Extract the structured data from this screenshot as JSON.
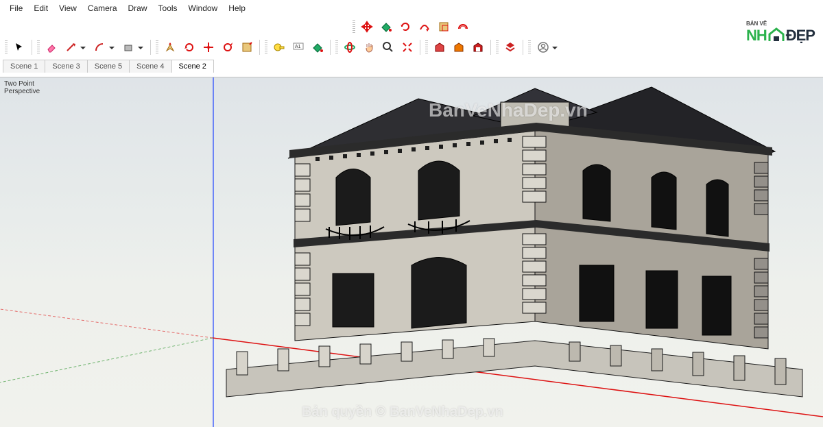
{
  "menu": [
    "File",
    "Edit",
    "View",
    "Camera",
    "Draw",
    "Tools",
    "Window",
    "Help"
  ],
  "top_toolbar": [
    {
      "name": "move-tool",
      "icon": "move-red"
    },
    {
      "name": "paint-bucket",
      "icon": "bucket"
    },
    {
      "name": "rotate-tool",
      "icon": "rotate-red"
    },
    {
      "name": "follow-me",
      "icon": "follow"
    },
    {
      "name": "scale-tool",
      "icon": "scale"
    },
    {
      "name": "offset-tool",
      "icon": "offset-red"
    }
  ],
  "main_toolbar_groups": [
    [
      {
        "name": "select-tool",
        "icon": "cursor",
        "dd": false
      }
    ],
    [
      {
        "name": "eraser-tool",
        "icon": "eraser",
        "dd": false
      },
      {
        "name": "line-tool",
        "icon": "pencil",
        "dd": true
      },
      {
        "name": "arc-tool",
        "icon": "arc",
        "dd": true
      },
      {
        "name": "rectangle-tool",
        "icon": "rect",
        "dd": true
      }
    ],
    [
      {
        "name": "push-pull",
        "icon": "pushpull"
      },
      {
        "name": "move-tool-2",
        "icon": "move2"
      },
      {
        "name": "rotate-tool-2",
        "icon": "rotate2"
      },
      {
        "name": "scale-tool-2",
        "icon": "scale2"
      },
      {
        "name": "offset-tool-2",
        "icon": "offset2"
      }
    ],
    [
      {
        "name": "tape-measure",
        "icon": "tape"
      },
      {
        "name": "text-tool",
        "icon": "text"
      },
      {
        "name": "paint-tool",
        "icon": "paint"
      }
    ],
    [
      {
        "name": "orbit",
        "icon": "orbit"
      },
      {
        "name": "pan",
        "icon": "pan"
      },
      {
        "name": "zoom",
        "icon": "zoom"
      },
      {
        "name": "zoom-extents",
        "icon": "zoomext"
      }
    ],
    [
      {
        "name": "warehouse-1",
        "icon": "wh1"
      },
      {
        "name": "warehouse-2",
        "icon": "wh2"
      },
      {
        "name": "warehouse-3",
        "icon": "wh3"
      }
    ],
    [
      {
        "name": "extension",
        "icon": "ruby"
      }
    ],
    [
      {
        "name": "user-account",
        "icon": "user",
        "dd": true
      }
    ]
  ],
  "scenes": [
    {
      "label": "Scene 1",
      "active": false
    },
    {
      "label": "Scene 3",
      "active": false
    },
    {
      "label": "Scene 5",
      "active": false
    },
    {
      "label": "Scene 4",
      "active": false
    },
    {
      "label": "Scene 2",
      "active": true
    }
  ],
  "viewport": {
    "projection_label": "Two Point\nPerspective"
  },
  "watermarks": {
    "top": "BanVeNhaDep.vn",
    "bottom": "Bản quyền © BanVeNhaDep.vn"
  },
  "logo": {
    "small": "BẢN VẼ",
    "text_green": "NH",
    "text_dark": "ĐẸP"
  }
}
